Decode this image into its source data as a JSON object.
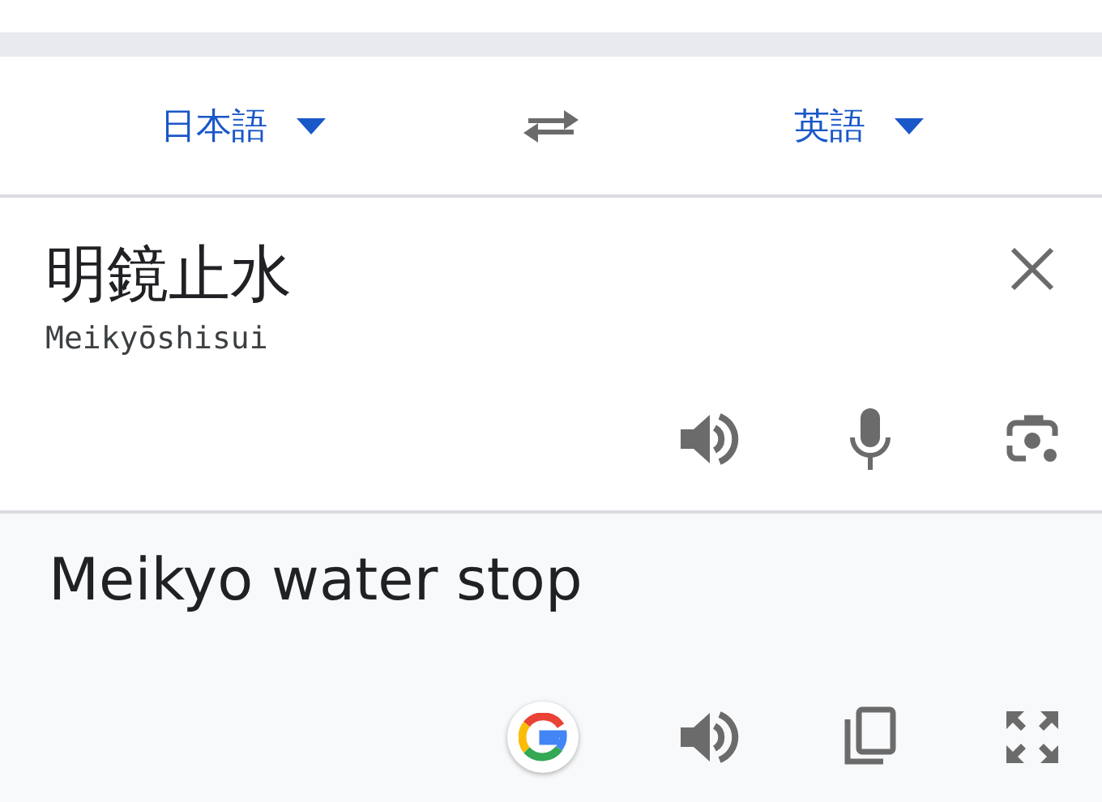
{
  "languages": {
    "source": "日本語",
    "target": "英語"
  },
  "source": {
    "text": "明鏡止水",
    "romanization": "Meikyōshisui"
  },
  "result": {
    "text": "Meikyo water stop"
  }
}
